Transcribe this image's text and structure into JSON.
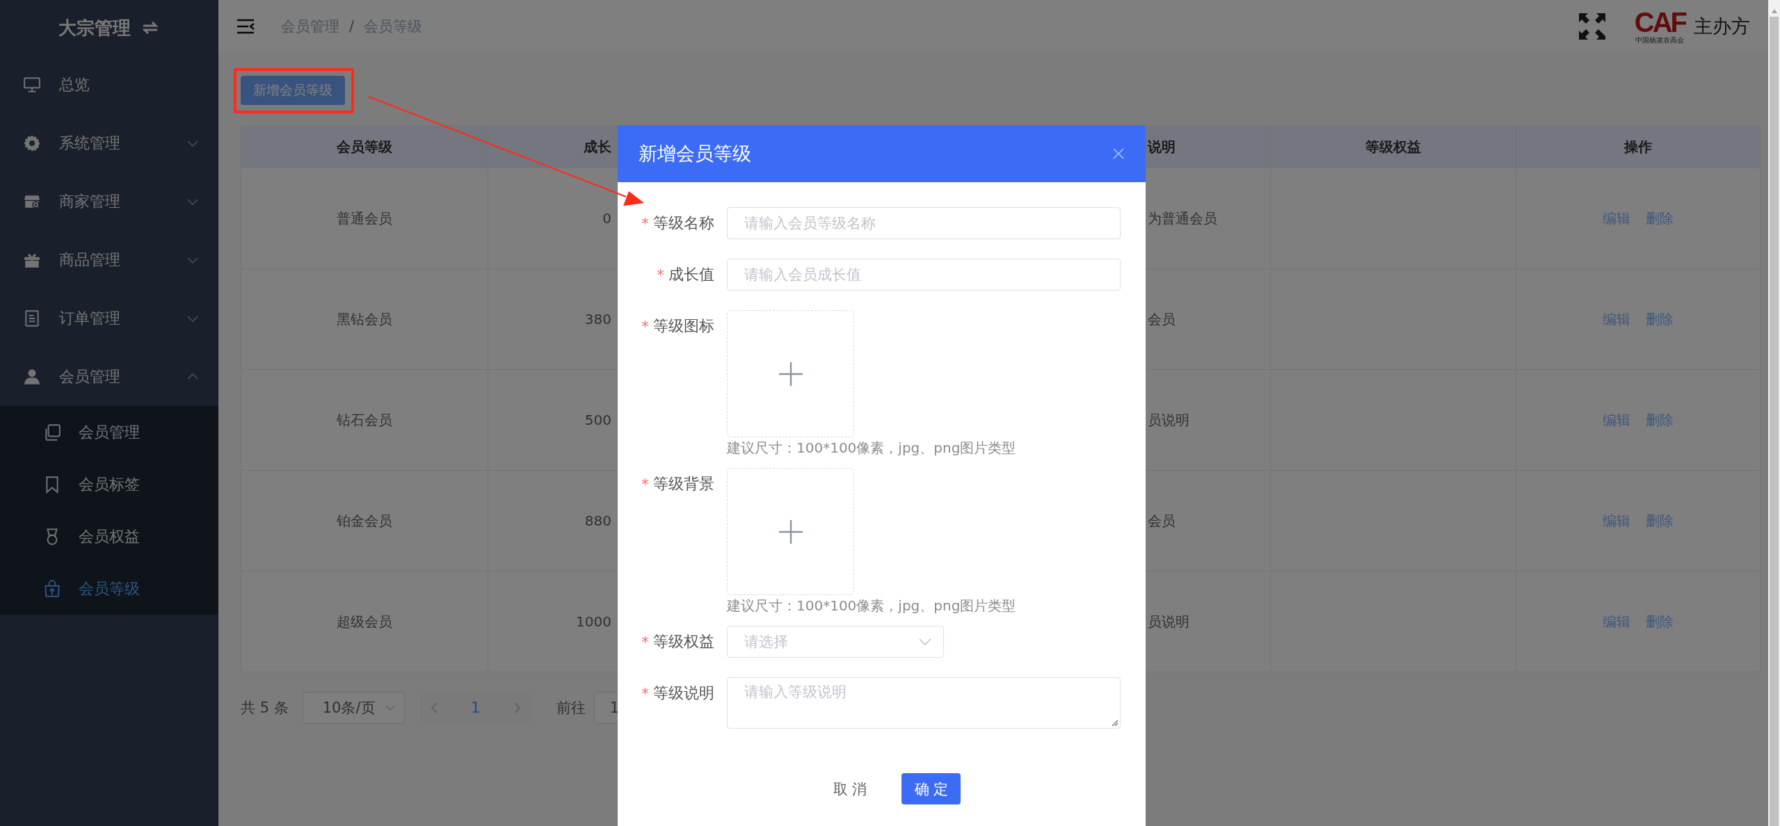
{
  "sidebar": {
    "title": "大宗管理",
    "items": [
      {
        "kind": "link",
        "label": "总览",
        "selected": false
      },
      {
        "kind": "group",
        "label": "系统管理",
        "expanded": false,
        "selected": false
      },
      {
        "kind": "group",
        "label": "商家管理",
        "expanded": false,
        "selected": false
      },
      {
        "kind": "group",
        "label": "商品管理",
        "expanded": false,
        "selected": false
      },
      {
        "kind": "group",
        "label": "订单管理",
        "expanded": false,
        "selected": false
      },
      {
        "kind": "group",
        "label": "会员管理",
        "expanded": true,
        "selected": false,
        "children": [
          {
            "label": "会员管理",
            "selected": false
          },
          {
            "label": "会员标签",
            "selected": false
          },
          {
            "label": "会员权益",
            "selected": false
          },
          {
            "label": "会员等级",
            "selected": true
          }
        ]
      }
    ]
  },
  "header": {
    "breadcrumb": [
      "会员管理",
      "会员等级"
    ],
    "separator": "/",
    "logo": {
      "mark": "CAF",
      "caption": "中国杨凌农高会"
    },
    "organizer": "主办方"
  },
  "toolbar": {
    "add_button": "新增会员等级"
  },
  "table": {
    "columns": [
      {
        "label": "会员等级"
      },
      {
        "label": "成长"
      },
      {
        "label": "说明"
      },
      {
        "label": "等级权益"
      },
      {
        "label": "操作"
      }
    ],
    "rows": [
      {
        "level": "普通会员",
        "growth": "0",
        "description": "为普通会员",
        "actions": [
          "编辑",
          "删除"
        ]
      },
      {
        "level": "黑钻会员",
        "growth": "380",
        "description": "会员",
        "actions": [
          "编辑",
          "删除"
        ]
      },
      {
        "level": "钻石会员",
        "growth": "500",
        "description": "员说明",
        "actions": [
          "编辑",
          "删除"
        ]
      },
      {
        "level": "铂金会员",
        "growth": "880",
        "description": "会员",
        "actions": [
          "编辑",
          "删除"
        ]
      },
      {
        "level": "超级会员",
        "growth": "1000",
        "description": "员说明",
        "actions": [
          "编辑",
          "删除"
        ]
      }
    ]
  },
  "pagination": {
    "total": "共 5 条",
    "page_size": "10条/页",
    "pages": [
      {
        "label": "1",
        "selected": true
      }
    ],
    "goto_label": "前往",
    "goto_value": "1"
  },
  "dialog": {
    "title": "新增会员等级",
    "required_mark": "*",
    "fields": [
      {
        "kind": "text",
        "label": "等级名称",
        "required": true,
        "placeholder": "请输入会员等级名称"
      },
      {
        "kind": "text",
        "label": "成长值",
        "required": true,
        "placeholder": "请输入会员成长值"
      },
      {
        "kind": "upload",
        "label": "等级图标",
        "required": true,
        "hint": "建议尺寸：100*100像素，jpg、png图片类型"
      },
      {
        "kind": "upload",
        "label": "等级背景",
        "required": true,
        "hint": "建议尺寸：100*100像素，jpg、png图片类型"
      },
      {
        "kind": "select",
        "label": "等级权益",
        "required": true,
        "placeholder": "请选择"
      },
      {
        "kind": "textarea",
        "label": "等级说明",
        "required": true,
        "placeholder": "请输入等级说明"
      }
    ],
    "buttons": [
      {
        "kind": "plain",
        "label": "取消"
      },
      {
        "kind": "primary",
        "label": "确定"
      }
    ]
  }
}
